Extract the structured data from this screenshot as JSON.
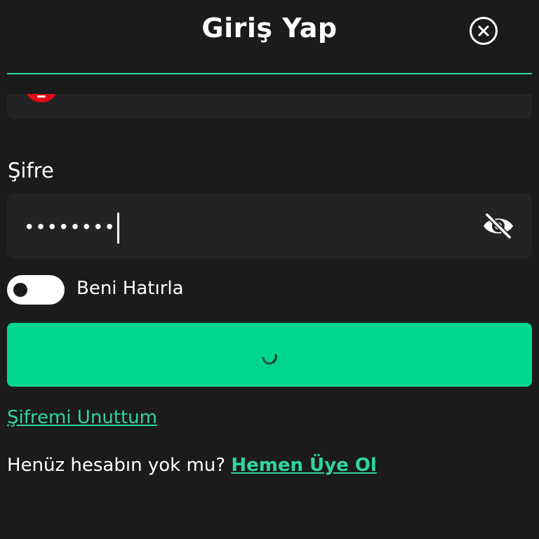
{
  "header": {
    "title": "Giriş Yap"
  },
  "form": {
    "password_label": "Şifre",
    "password_value": "••••••••",
    "remember_label": "Beni Hatırla",
    "remember_checked": false,
    "submit_state": "loading"
  },
  "links": {
    "forgot_password": "Şifremi Unuttum",
    "no_account_text": "Henüz hesabın yok mu?",
    "signup": "Hemen Üye Ol"
  },
  "icons": {
    "close": "close-circle-icon",
    "toggle_visibility": "eye-slash-icon",
    "country_flag": "turkey-flag-icon",
    "loading": "loading-spinner-icon"
  },
  "colors": {
    "background": "#1b1b1c",
    "field_background": "#232325",
    "accent": "#2fd69a",
    "button": "#00d68f",
    "text": "#ffffff",
    "flag_red": "#e30a17"
  }
}
